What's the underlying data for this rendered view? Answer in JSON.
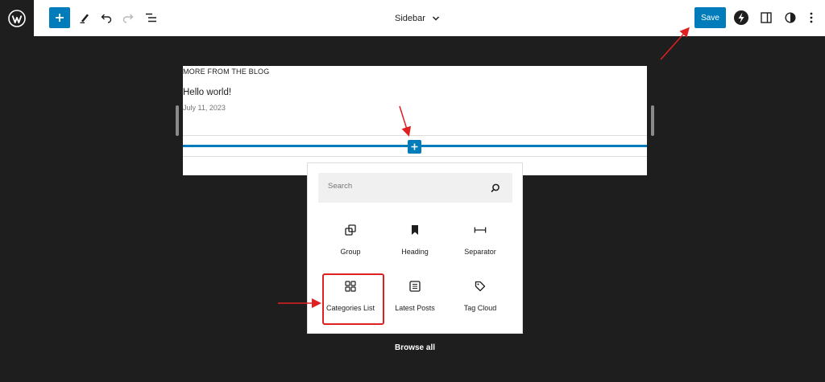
{
  "toolbar": {
    "logo_icon": "wordpress-icon",
    "add_icon": "plus-icon",
    "tools_icon": "pencil-icon",
    "undo_icon": "undo-icon",
    "redo_icon": "redo-icon",
    "list_view_icon": "list-view-icon",
    "document_title": "Sidebar",
    "save_label": "Save",
    "accent_color": "#007cba"
  },
  "canvas": {
    "heading": "MORE FROM THE BLOG",
    "post_title": "Hello world!",
    "post_date": "July 11, 2023"
  },
  "inserter": {
    "search_placeholder": "Search",
    "blocks": [
      {
        "label": "Group",
        "icon": "group-icon"
      },
      {
        "label": "Heading",
        "icon": "bookmark-icon"
      },
      {
        "label": "Separator",
        "icon": "separator-icon"
      },
      {
        "label": "Categories List",
        "icon": "categories-icon"
      },
      {
        "label": "Latest Posts",
        "icon": "latest-posts-icon"
      },
      {
        "label": "Tag Cloud",
        "icon": "tag-icon"
      }
    ],
    "browse_all_label": "Browse all"
  },
  "annotation_color": "#e02020"
}
